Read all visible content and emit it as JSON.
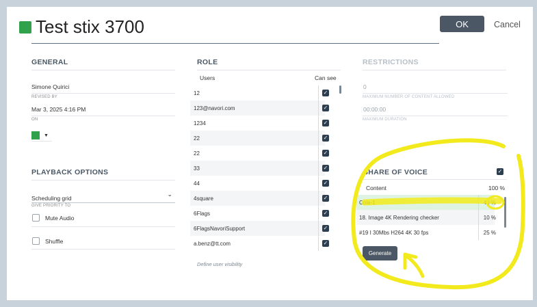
{
  "header": {
    "title": "Test stix 3700",
    "ok_label": "OK",
    "cancel_label": "Cancel",
    "color": "#2fa24b"
  },
  "general": {
    "title": "GENERAL",
    "revised_by_value": "Simone Quirici",
    "revised_by_label": "REVISED BY",
    "on_value": "Mar 3, 2025 4:16 PM",
    "on_label": "ON",
    "color_value": "#2fa24b"
  },
  "playback": {
    "title": "PLAYBACK OPTIONS",
    "priority_value": "Scheduling grid",
    "priority_label": "GIVE PRIORITY TO",
    "mute_label": "Mute Audio",
    "shuffle_label": "Shuffle"
  },
  "role": {
    "title": "ROLE",
    "col_users": "Users",
    "col_can_see": "Can see",
    "users": [
      "12",
      "123@navori.com",
      "1234",
      "22",
      "22",
      "33",
      "44",
      "4square",
      "6Flags",
      "6FlagsNavoriSupport",
      "a.benz@tt.com"
    ],
    "hint": "Define user visibility"
  },
  "restrictions": {
    "title": "RESTRICTIONS",
    "max_content_value": "0",
    "max_content_label": "MAXIMUM NUMBER OF CONTENT ALLOWED",
    "max_duration_value": "00:00:00",
    "max_duration_label": "MAXIMUM DURATION"
  },
  "sov": {
    "title": "SHARE OF VOICE",
    "header_content": "Content",
    "header_pct": "100 %",
    "rows": [
      {
        "name": "Cola-1",
        "pct": "40 %"
      },
      {
        "name": "18. Image 4K Rendering checker",
        "pct": "10 %"
      },
      {
        "name": "#19 I 30Mbs H264 4K 30 fps",
        "pct": "25 %"
      }
    ],
    "generate_label": "Generate"
  },
  "colors": {
    "accent": "#4b5764",
    "checkbox": "#2c3e50",
    "annotation": "#f2ea1c"
  }
}
